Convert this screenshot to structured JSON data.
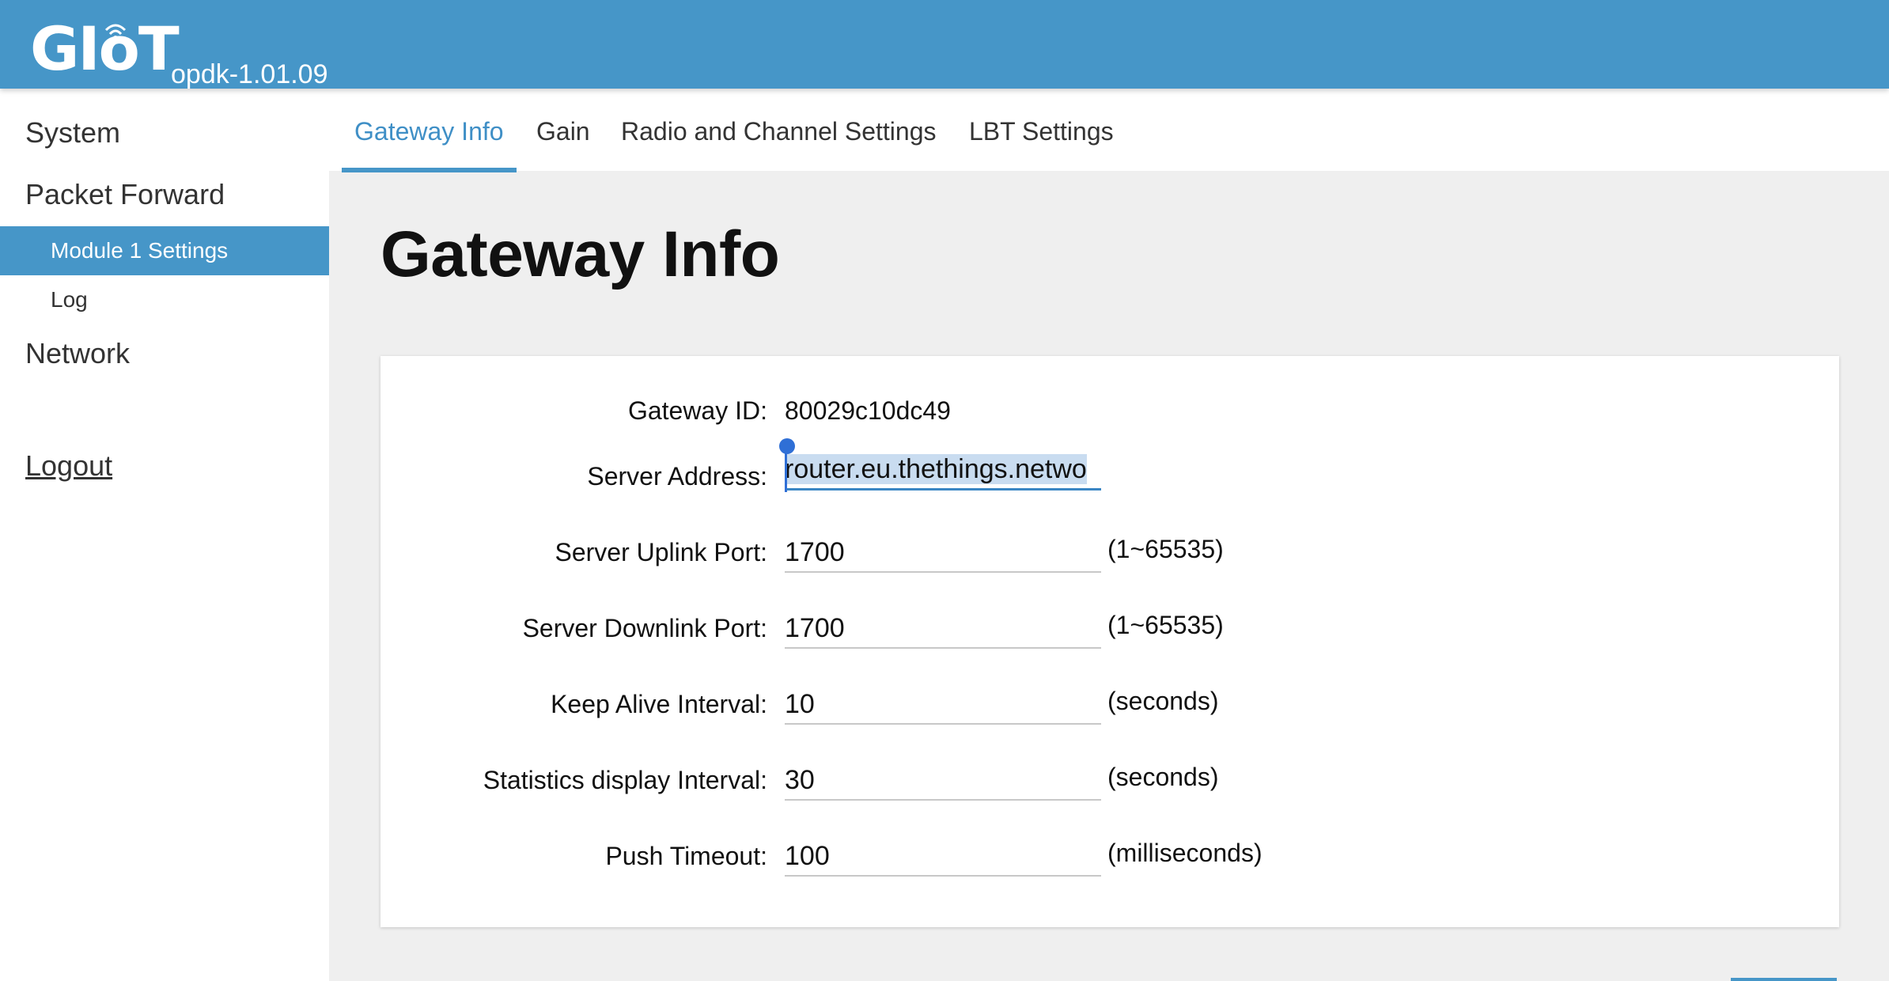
{
  "header": {
    "logo_text": "GIoT",
    "version": "opdk-1.01.09",
    "brand_color": "#4696c8"
  },
  "sidebar": {
    "items": [
      {
        "label": "System"
      },
      {
        "label": "Packet Forward"
      },
      {
        "label": "Module 1 Settings",
        "active": true
      },
      {
        "label": "Log"
      },
      {
        "label": "Network"
      }
    ],
    "logout_label": "Logout"
  },
  "tabs": [
    {
      "label": "Gateway Info",
      "active": true
    },
    {
      "label": "Gain"
    },
    {
      "label": "Radio and Channel Settings"
    },
    {
      "label": "LBT Settings"
    }
  ],
  "page": {
    "title": "Gateway Info"
  },
  "form": {
    "gateway_id_label": "Gateway ID:",
    "gateway_id_value": "80029c10dc49",
    "server_address_label": "Server Address:",
    "server_address_value": "router.eu.thethings.netwo",
    "uplink_label": "Server Uplink Port:",
    "uplink_value": "1700",
    "uplink_hint": "(1~65535)",
    "downlink_label": "Server Downlink Port:",
    "downlink_value": "1700",
    "downlink_hint": "(1~65535)",
    "keepalive_label": "Keep Alive Interval:",
    "keepalive_value": "10",
    "keepalive_hint": "(seconds)",
    "stats_label": "Statistics display Interval:",
    "stats_value": "30",
    "stats_hint": "(seconds)",
    "push_label": "Push Timeout:",
    "push_value": "100",
    "push_hint": "(milliseconds)"
  }
}
